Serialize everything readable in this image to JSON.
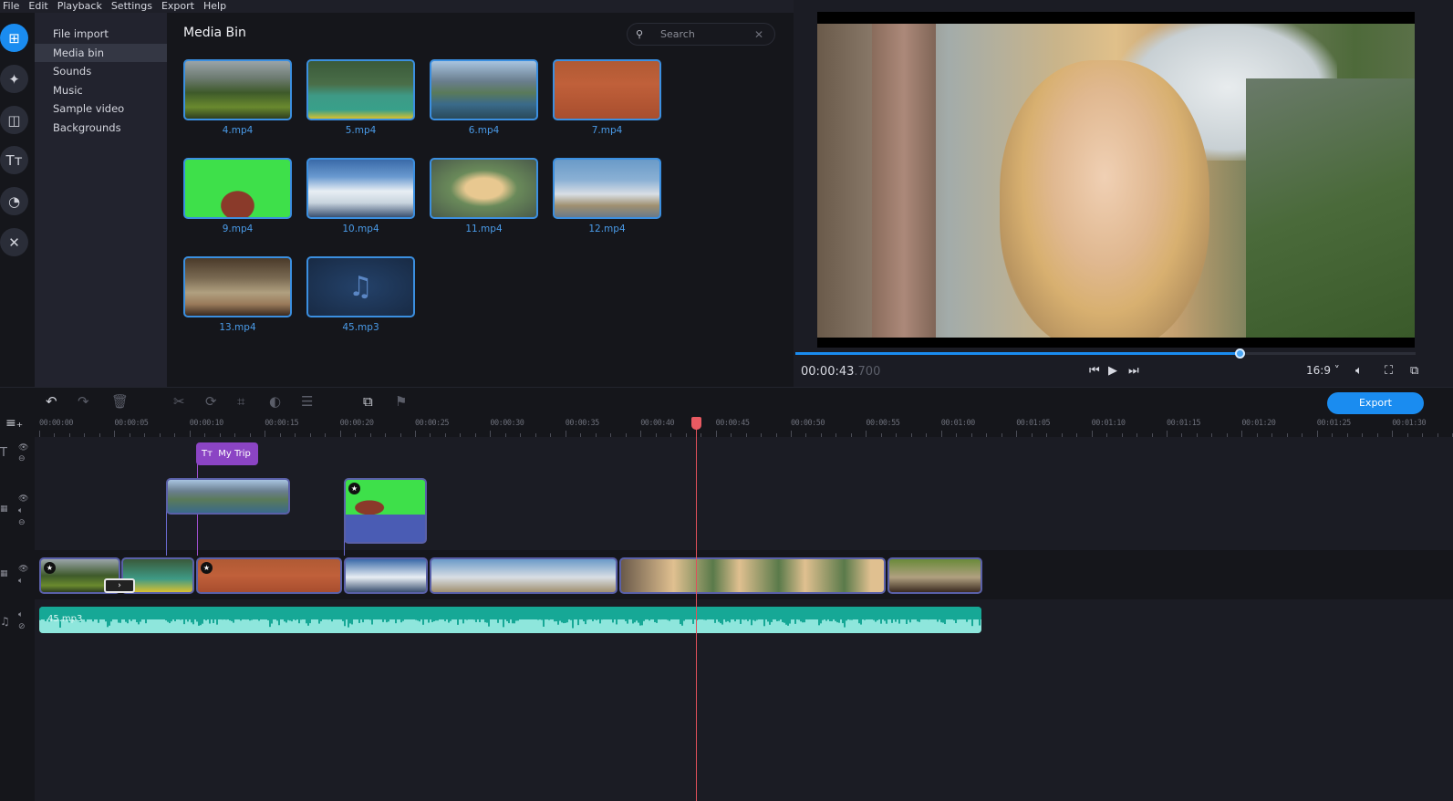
{
  "menu": [
    {
      "label": "File"
    },
    {
      "label": "Edit"
    },
    {
      "label": "Playback"
    },
    {
      "label": "Settings"
    },
    {
      "label": "Export"
    },
    {
      "label": "Help"
    }
  ],
  "rail": [
    {
      "name": "import-icon",
      "glyph": "⊞",
      "active": true
    },
    {
      "name": "magic-wand-icon",
      "glyph": "✦",
      "active": false
    },
    {
      "name": "transitions-icon",
      "glyph": "◫",
      "active": false
    },
    {
      "name": "titles-icon",
      "glyph": "Tт",
      "active": false
    },
    {
      "name": "stickers-icon",
      "glyph": "◔",
      "active": false
    },
    {
      "name": "tools-icon",
      "glyph": "✕",
      "active": false
    }
  ],
  "categories": [
    {
      "label": "File import",
      "active": false
    },
    {
      "label": "Media bin",
      "active": true
    },
    {
      "label": "Sounds",
      "active": false
    },
    {
      "label": "Music",
      "active": false
    },
    {
      "label": "Sample video",
      "active": false
    },
    {
      "label": "Backgrounds",
      "active": false
    }
  ],
  "bin": {
    "title": "Media Bin",
    "search_placeholder": "Search",
    "items": [
      {
        "label": "4.mp4",
        "bg": "linear-gradient(180deg,#9aa4a8 0%,#6c7a70 30%,#3e5a2a 55%,#6a8a2e 80%,#2e3e20 100%)"
      },
      {
        "label": "5.mp4",
        "bg": "linear-gradient(180deg,#3a5a3a 0%,#4a6e48 40%,#3e9a86 60%,#38a08a 85%,#d8c030 100%)"
      },
      {
        "label": "6.mp4",
        "bg": "linear-gradient(180deg,#a8c4e0 0%,#6a7e8e 35%,#5a7a5a 55%,#3a6a8a 75%,#2a4a5a 100%)"
      },
      {
        "label": "7.mp4",
        "bg": "linear-gradient(180deg,#b05a34 0%,#c0603a 40%,#a84e2e 100%)"
      },
      {
        "label": "9.mp4",
        "bg": "radial-gradient(ellipse at 50% 80%,#8a3a2a 0 22%,#3ee04a 23%)"
      },
      {
        "label": "10.mp4",
        "bg": "linear-gradient(180deg,#3a6aa8 0%,#6a9ad0 30%,#e8eef4 55%,#c8d4de 75%,#3a5070 100%)"
      },
      {
        "label": "11.mp4",
        "bg": "radial-gradient(ellipse at 50% 50%,#e8c890 0 25%,#6a8a5a 45%,#4a5a4a 100%)"
      },
      {
        "label": "12.mp4",
        "bg": "linear-gradient(180deg,#6a9ac8 0%,#8ab0d4 35%,#d8dee4 60%,#a09070 80%,#6a7a8a 100%)"
      },
      {
        "label": "13.mp4",
        "bg": "linear-gradient(180deg,#4a3a2a 0%,#7a6a52 35%,#b0a080 60%,#9a7a5a 80%,#3a2a20 100%)"
      },
      {
        "label": "45.mp3",
        "bg": "radial-gradient(ellipse at 50% 50%,#24426a 0%,#182a44 100%)",
        "audio": true
      }
    ]
  },
  "preview": {
    "timecode_main": "00:00:43",
    "timecode_ms": ".700",
    "progress": 0.716,
    "aspect": "16:9 ˅"
  },
  "toolbar": {
    "export_label": "Export"
  },
  "ruler": {
    "ticks": [
      "00:00:00",
      "00:00:05",
      "00:00:10",
      "00:00:15",
      "00:00:20",
      "00:00:25",
      "00:00:30",
      "00:00:35",
      "00:00:40",
      "00:00:45",
      "00:00:50",
      "00:00:55",
      "00:01:00",
      "00:01:05",
      "00:01:10",
      "00:01:15",
      "00:01:20",
      "00:01:25",
      "00:01:30"
    ],
    "playhead_seconds": 43.7
  },
  "timeline": {
    "title_clip": {
      "label": "My Trip"
    },
    "overlay_clips": [
      {
        "name": "overlay-clip-6",
        "bg": "linear-gradient(180deg,#a8c4e0 0%,#6a7e8e 35%,#5a7a5a 60%,#3a6a8a 100%)"
      },
      {
        "name": "overlay-clip-9",
        "bg": "radial-gradient(ellipse at 30% 80%,#8a3a2a 0 18%,#3ee04a 19%)"
      }
    ],
    "main_clips": [
      {
        "name": "main-clip-4",
        "bg": "linear-gradient(180deg,#9aa4a8 0%,#3e5a2a 50%,#6a8a2e 80%,#2e3e20 100%)",
        "star": true
      },
      {
        "name": "main-clip-5",
        "bg": "linear-gradient(180deg,#3a5a3a 0%,#3e9a86 60%,#d8c030 100%)",
        "star": false
      },
      {
        "name": "main-clip-7",
        "bg": "linear-gradient(180deg,#b05a34 0%,#c0603a 50%,#a84e2e 100%)",
        "star": true
      },
      {
        "name": "main-clip-10",
        "bg": "linear-gradient(180deg,#3a6aa8 0%,#e8eef4 55%,#3a5070 100%)",
        "star": false
      },
      {
        "name": "main-clip-12",
        "bg": "linear-gradient(180deg,#6a9ac8 0%,#d8dee4 55%,#a09070 100%)",
        "star": false
      },
      {
        "name": "main-clip-11",
        "bg": "linear-gradient(90deg,#6a5a4a 0%,#e0c090 20%,#5a7a4a 35%,#e0c090 45%,#5a7a4a 60%,#e0c090 70%,#5a7a4a 85%,#e0c090 95%)",
        "star": false
      },
      {
        "name": "main-clip-13",
        "bg": "linear-gradient(180deg,#6a8a3a 0%,#b0a080 55%,#3a2a20 100%)",
        "star": false
      }
    ],
    "audio_clip": {
      "label": "45.mp3"
    }
  }
}
